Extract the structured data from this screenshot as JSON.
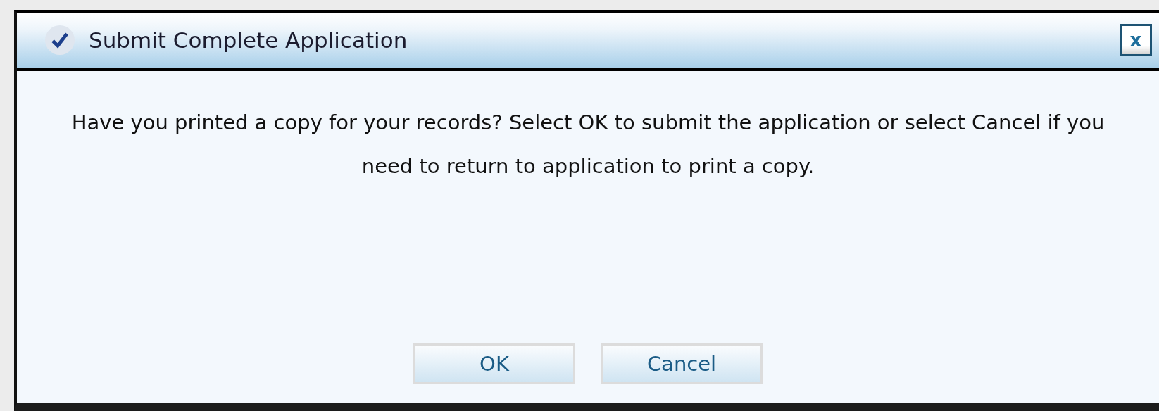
{
  "dialog": {
    "title": "Submit Complete Application",
    "close_label": "x",
    "message": "Have you printed a copy for your records? Select OK to submit the application or select Cancel if you need to return to application to print a copy.",
    "buttons": [
      "OK",
      "Cancel"
    ]
  }
}
